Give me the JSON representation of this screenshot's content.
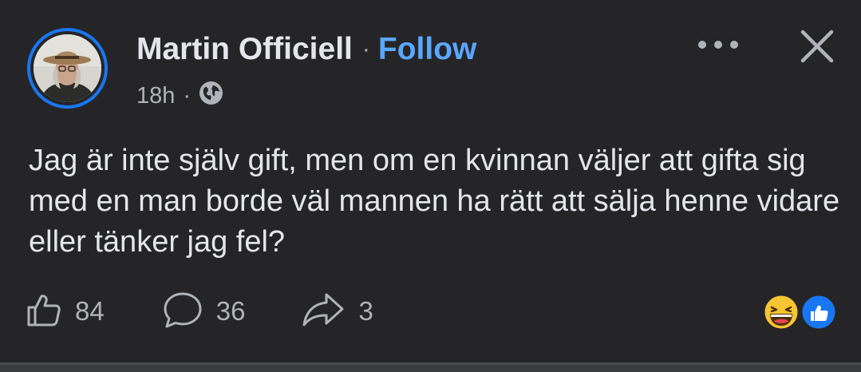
{
  "post": {
    "author": {
      "name": "Martin Officiell",
      "separator": "·",
      "follow_label": "Follow"
    },
    "meta": {
      "time": "18h",
      "separator": "·",
      "audience_icon": "globe-icon"
    },
    "text": "Jag är inte själv gift, men om en kvinnan väljer att gifta sig med en man borde väl mannen ha rätt att sälja henne vidare eller tänker jag fel?",
    "actions": {
      "likes": "84",
      "comments": "36",
      "shares": "3"
    },
    "reactions": [
      "laughing-emoji-icon",
      "like-reaction-icon"
    ],
    "icons": {
      "more": "more-horizontal-icon",
      "close": "close-icon",
      "like": "thumbs-up-icon",
      "comment": "comment-bubble-icon",
      "share": "share-arrow-icon"
    },
    "colors": {
      "background": "#252527",
      "text": "#e4e6eb",
      "secondary_text": "#b0b3b8",
      "follow": "#5aa7ff",
      "avatar_ring": "#1877f2"
    }
  }
}
